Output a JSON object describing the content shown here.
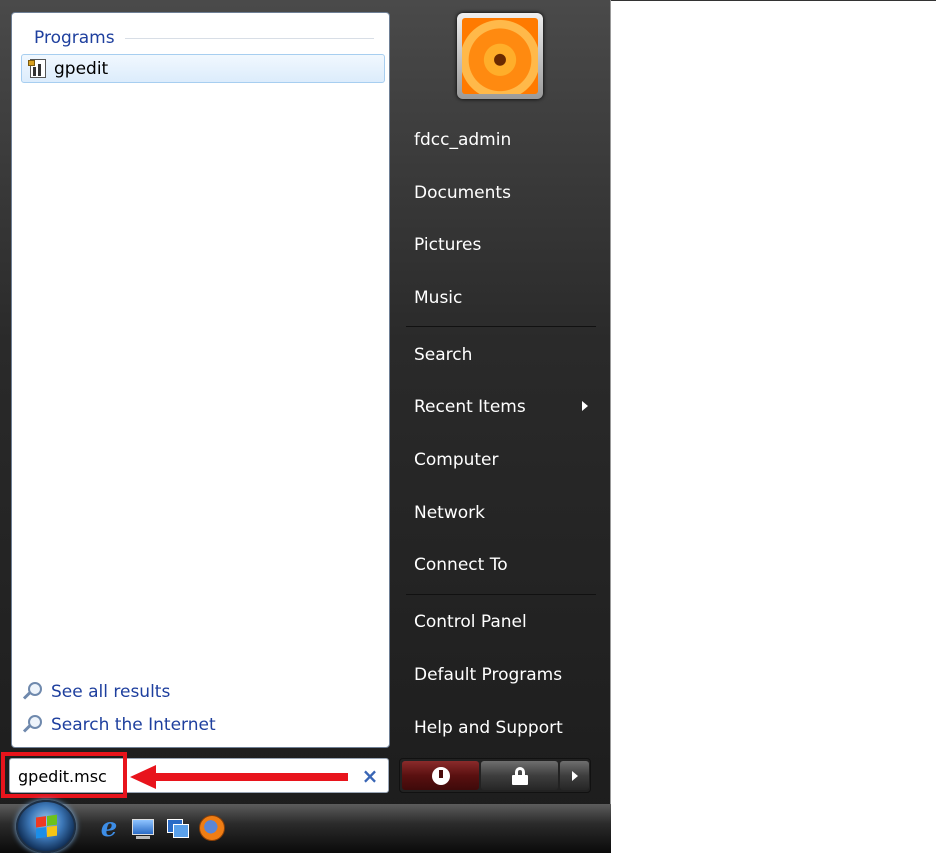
{
  "start_menu": {
    "programs_header": "Programs",
    "programs": [
      {
        "label": "gpedit",
        "icon": "group-policy-editor-icon"
      }
    ],
    "see_all_results": "See all results",
    "search_internet": "Search the Internet",
    "search_value": "gpedit.msc",
    "clear_symbol": "×",
    "right_items": {
      "user": "fdcc_admin",
      "documents": "Documents",
      "pictures": "Pictures",
      "music": "Music",
      "search": "Search",
      "recent_items": "Recent Items",
      "computer": "Computer",
      "network": "Network",
      "connect_to": "Connect To",
      "control_panel": "Control Panel",
      "default_programs": "Default Programs",
      "help_support": "Help and Support"
    }
  },
  "colors": {
    "link_blue": "#1e3f9e",
    "highlight_red": "#e8141c",
    "menu_dark": "#1c1c1c"
  }
}
